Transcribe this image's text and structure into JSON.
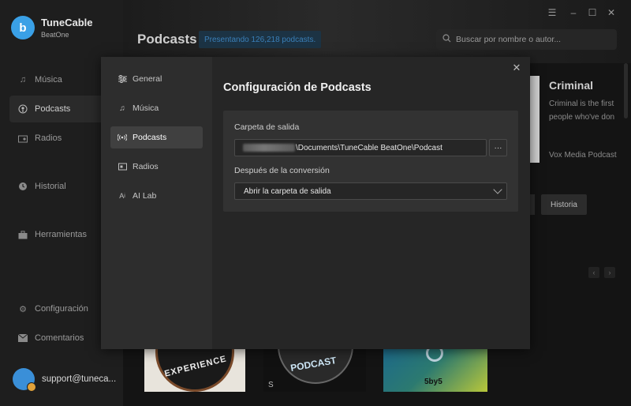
{
  "app": {
    "name": "TuneCable",
    "sub": "BeatOne",
    "logo_letter": "b"
  },
  "sidebar": {
    "items": [
      {
        "label": "Música",
        "icon": "music-icon"
      },
      {
        "label": "Podcasts",
        "icon": "podcast-icon",
        "active": true
      },
      {
        "label": "Radios",
        "icon": "radio-icon"
      },
      {
        "label": "Historial",
        "icon": "clock-icon"
      },
      {
        "label": "Herramientas",
        "icon": "toolbox-icon"
      },
      {
        "label": "Configuración",
        "icon": "gear-icon"
      },
      {
        "label": "Comentarios",
        "icon": "mail-icon"
      }
    ],
    "user_email": "support@tuneca..."
  },
  "header": {
    "title": "Podcasts",
    "count_chip": "Presentando 126,218 podcasts.",
    "search_placeholder": "Buscar por nombre o autor..."
  },
  "window_controls": [
    "menu",
    "minimize",
    "maximize",
    "close"
  ],
  "featured": {
    "title": "Criminal",
    "desc_line1": "Criminal is the first",
    "desc_line2": "people who've don",
    "publisher": "Vox Media Podcast",
    "history_button": "Historia"
  },
  "cards": [
    {
      "text": "EXPERIENCE"
    },
    {
      "text": "PODCAST",
      "sub": "S"
    },
    {
      "text": "5by5"
    }
  ],
  "modal": {
    "title": "Configuración de Podcasts",
    "nav": [
      {
        "label": "General",
        "icon": "sliders-icon"
      },
      {
        "label": "Música",
        "icon": "music-icon"
      },
      {
        "label": "Podcasts",
        "icon": "podcast-icon",
        "active": true
      },
      {
        "label": "Radios",
        "icon": "radio-icon"
      },
      {
        "label": "AI Lab",
        "icon": "ai-icon"
      }
    ],
    "output_folder_label": "Carpeta de salida",
    "output_folder_value": "\\Documents\\TuneCable BeatOne\\Podcast",
    "browse_button": "···",
    "after_conversion_label": "Después de la conversión",
    "after_conversion_value": "Abrir la carpeta de salida",
    "close_icon": "close-icon"
  }
}
